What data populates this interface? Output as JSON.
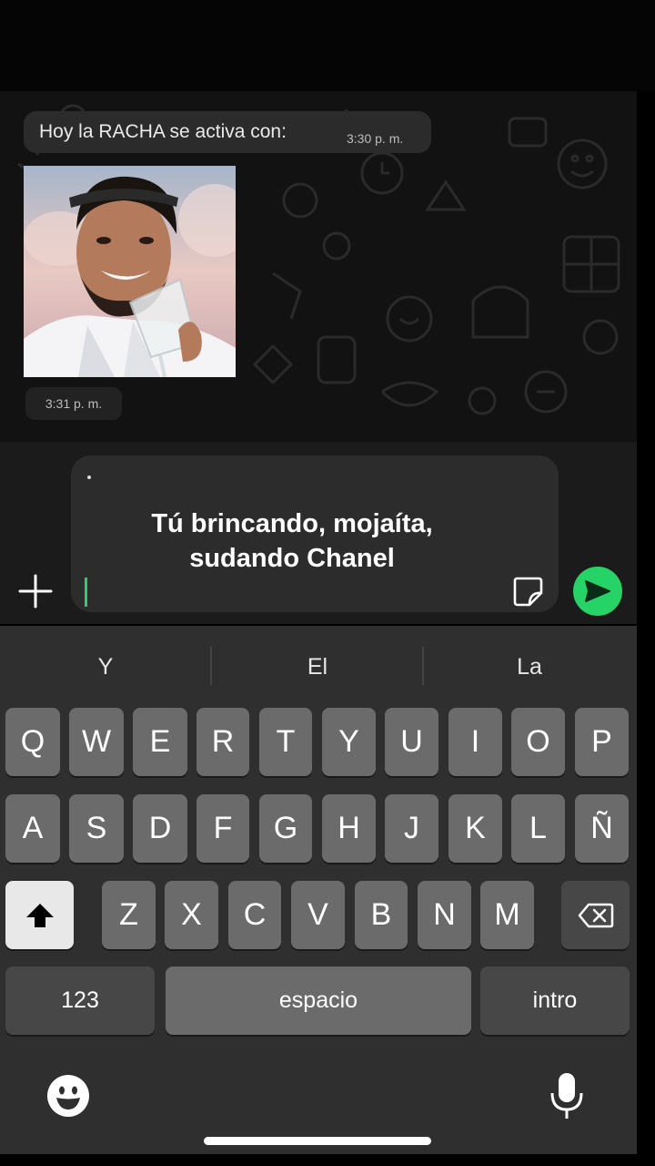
{
  "messages": [
    {
      "text": "Hoy la RACHA se activa con:",
      "time": "3:30 p. m."
    },
    {
      "sticker": "man-with-wine-glass",
      "time": "3:31 p. m."
    }
  ],
  "composer": {
    "caption_line1": "Tú brincando, mojaíta,",
    "caption_line2": "sudando Chanel",
    "plus_icon": "plus-icon",
    "sticker_icon": "sticker-icon",
    "send_icon": "send-icon"
  },
  "keyboard": {
    "suggestions": [
      "Y",
      "El",
      "La"
    ],
    "row1": [
      "Q",
      "W",
      "E",
      "R",
      "T",
      "Y",
      "U",
      "I",
      "O",
      "P"
    ],
    "row2": [
      "A",
      "S",
      "D",
      "F",
      "G",
      "H",
      "J",
      "K",
      "L",
      "Ñ"
    ],
    "row3": [
      "Z",
      "X",
      "C",
      "V",
      "B",
      "N",
      "M"
    ],
    "numbers_label": "123",
    "space_label": "espacio",
    "enter_label": "intro"
  },
  "colors": {
    "accent": "#25d366",
    "chat_bg": "#121212",
    "bubble": "#2b2b2b",
    "key": "#6b6b6b",
    "key_dark": "#474747"
  }
}
